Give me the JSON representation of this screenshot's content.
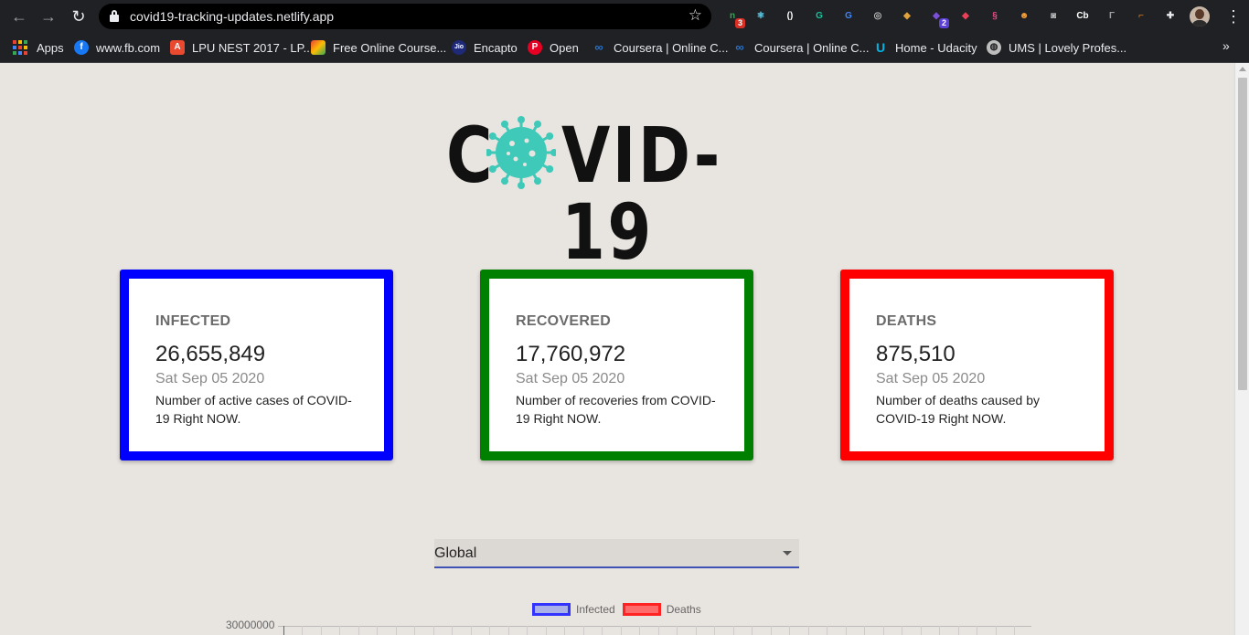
{
  "browser": {
    "url": "covid19-tracking-updates.netlify.app",
    "extensions": [
      {
        "icon": "green-extension-icon",
        "color": "#34a853",
        "glyph": "n",
        "badge": "3"
      },
      {
        "icon": "react-devtools-icon",
        "color": "#61dafb",
        "glyph": "⚛"
      },
      {
        "icon": "white-circle-extension-icon",
        "color": "#ffffff",
        "glyph": "()"
      },
      {
        "icon": "grammarly-icon",
        "color": "#15c39a",
        "glyph": "G"
      },
      {
        "icon": "google-translate-icon",
        "color": "#4285f4",
        "glyph": "G"
      },
      {
        "icon": "target-extension-icon",
        "color": "#bdbdbd",
        "glyph": "◎"
      },
      {
        "icon": "colorful-extension-icon",
        "color": "#e0a33b",
        "glyph": "◆"
      },
      {
        "icon": "purple-extension-icon",
        "color": "#7b4fd6",
        "glyph": "◆",
        "badge": "2"
      },
      {
        "icon": "color-picker-icon",
        "color": "#e94057",
        "glyph": "◆"
      },
      {
        "icon": "swirl-extension-icon",
        "color": "#ea4c89",
        "glyph": "§"
      },
      {
        "icon": "monkey-extension-icon",
        "color": "#f7a23b",
        "glyph": "☻"
      },
      {
        "icon": "camera-icon",
        "color": "#bdbdbd",
        "glyph": "◙"
      },
      {
        "icon": "cb-extension-icon",
        "color": "#ffffff",
        "glyph": "Cb"
      },
      {
        "icon": "grey-f-extension-icon",
        "color": "#9aa0a6",
        "glyph": "Γ"
      },
      {
        "icon": "orange-extension-icon",
        "color": "#f28b24",
        "glyph": "⌐"
      },
      {
        "icon": "puzzle-icon",
        "color": "#e8eaed",
        "glyph": "✚"
      }
    ]
  },
  "bookmarks": [
    {
      "label": "Apps",
      "icon": "apps-grid-icon",
      "color": "#ea4335"
    },
    {
      "label": "www.fb.com",
      "icon": "facebook-icon",
      "color": "#1877f2"
    },
    {
      "label": "LPU NEST 2017 - LP...",
      "icon": "lpu-icon",
      "color": "#e8492f"
    },
    {
      "label": "Free Online Course...",
      "icon": "courses-icon",
      "color": "#f4b400"
    },
    {
      "label": "Encapto",
      "icon": "jio-icon",
      "color": "#1e2a78"
    },
    {
      "label": "Open",
      "icon": "pinterest-icon",
      "color": "#e60023"
    },
    {
      "label": "Coursera | Online C...",
      "icon": "coursera-icon",
      "color": "#2a73cc"
    },
    {
      "label": "Coursera | Online C...",
      "icon": "coursera-icon",
      "color": "#2a73cc"
    },
    {
      "label": "Home - Udacity",
      "icon": "udacity-icon",
      "color": "#02b3e4"
    },
    {
      "label": "UMS | Lovely Profes...",
      "icon": "globe-icon",
      "color": "#bdbdbd"
    }
  ],
  "logo": {
    "prefix": "C",
    "rest": "VID-19",
    "virus_color": "#3ec9b9"
  },
  "cards": [
    {
      "label": "INFECTED",
      "count": "26,655,849",
      "date": "Sat Sep 05 2020",
      "description": "Number of active cases of COVID-19 Right NOW.",
      "border_color": "#0000ff"
    },
    {
      "label": "RECOVERED",
      "count": "17,760,972",
      "date": "Sat Sep 05 2020",
      "description": "Number of recoveries from COVID-19 Right NOW.",
      "border_color": "#008000"
    },
    {
      "label": "DEATHS",
      "count": "875,510",
      "date": "Sat Sep 05 2020",
      "description": "Number of deaths caused by COVID-19 Right NOW.",
      "border_color": "#ff0000"
    }
  ],
  "country_select": {
    "value": "Global"
  },
  "chart": {
    "legend": [
      {
        "label": "Infected",
        "color": "#3333ff",
        "fill": "#aab0e8"
      },
      {
        "label": "Deaths",
        "color": "#ff2222",
        "fill": "#ff6b6b"
      }
    ],
    "y_top_tick": "30000000"
  }
}
